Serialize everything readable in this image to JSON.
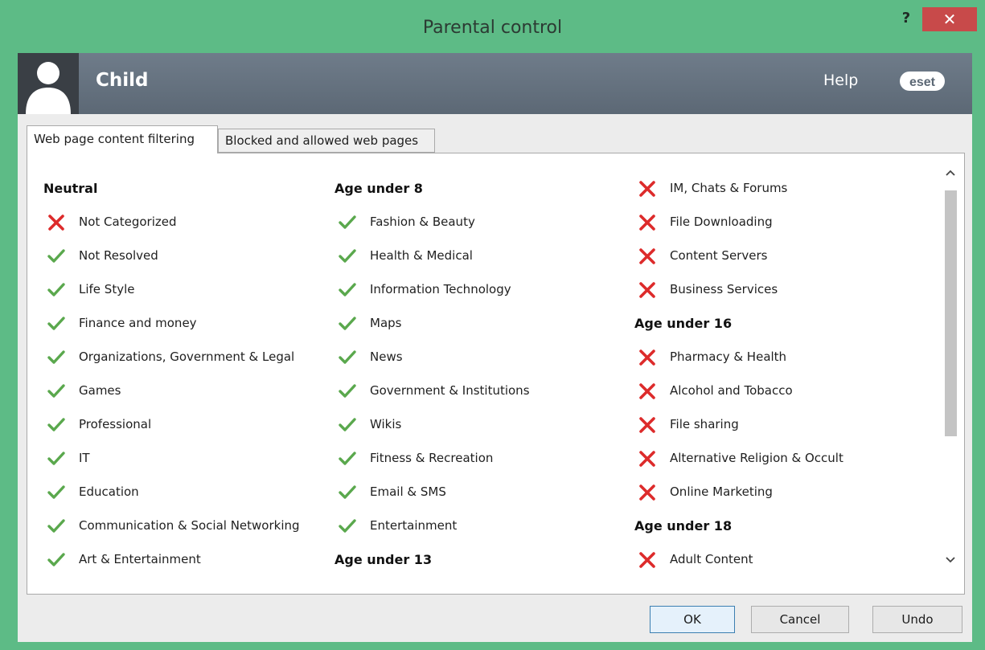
{
  "window": {
    "title": "Parental control",
    "help_glyph": "?",
    "close_glyph": "✕",
    "frame_color": "#5dbb86",
    "close_color": "#c84a4a"
  },
  "header": {
    "name": "Child",
    "help": "Help",
    "logo_text": "eset"
  },
  "tabs": [
    {
      "label": "Web page content filtering",
      "active": true
    },
    {
      "label": "Blocked and allowed web pages",
      "active": false
    }
  ],
  "columns": [
    {
      "groups": [
        {
          "title": "Neutral",
          "items": [
            {
              "label": "Not Categorized",
              "allowed": false
            },
            {
              "label": "Not Resolved",
              "allowed": true
            },
            {
              "label": "Life Style",
              "allowed": true
            },
            {
              "label": "Finance and money",
              "allowed": true
            },
            {
              "label": "Organizations, Government & Legal",
              "allowed": true
            },
            {
              "label": "Games",
              "allowed": true
            },
            {
              "label": "Professional",
              "allowed": true
            },
            {
              "label": "IT",
              "allowed": true
            },
            {
              "label": "Education",
              "allowed": true
            },
            {
              "label": "Communication & Social Networking",
              "allowed": true
            },
            {
              "label": "Art & Entertainment",
              "allowed": true
            }
          ]
        }
      ]
    },
    {
      "groups": [
        {
          "title": "Age under 8",
          "items": [
            {
              "label": "Fashion & Beauty",
              "allowed": true
            },
            {
              "label": "Health & Medical",
              "allowed": true
            },
            {
              "label": "Information Technology",
              "allowed": true
            },
            {
              "label": "Maps",
              "allowed": true
            },
            {
              "label": "News",
              "allowed": true
            },
            {
              "label": "Government & Institutions",
              "allowed": true
            },
            {
              "label": "Wikis",
              "allowed": true
            },
            {
              "label": "Fitness & Recreation",
              "allowed": true
            },
            {
              "label": "Email & SMS",
              "allowed": true
            },
            {
              "label": "Entertainment",
              "allowed": true
            }
          ]
        },
        {
          "title": "Age under 13",
          "items": []
        }
      ]
    },
    {
      "groups": [
        {
          "title": "",
          "items": [
            {
              "label": "IM, Chats & Forums",
              "allowed": false
            },
            {
              "label": "File Downloading",
              "allowed": false
            },
            {
              "label": "Content Servers",
              "allowed": false
            },
            {
              "label": "Business Services",
              "allowed": false
            }
          ]
        },
        {
          "title": "Age under 16",
          "items": [
            {
              "label": "Pharmacy & Health",
              "allowed": false
            },
            {
              "label": "Alcohol and Tobacco",
              "allowed": false
            },
            {
              "label": "File sharing",
              "allowed": false
            },
            {
              "label": "Alternative Religion & Occult",
              "allowed": false
            },
            {
              "label": "Online Marketing",
              "allowed": false
            }
          ]
        },
        {
          "title": "Age under 18",
          "items": [
            {
              "label": "Adult Content",
              "allowed": false
            }
          ]
        }
      ]
    }
  ],
  "icons": {
    "allowed": "check-icon",
    "blocked": "cross-icon",
    "allowed_color": "#5aa84d",
    "blocked_color": "#dd2b2b"
  },
  "buttons": {
    "ok": "OK",
    "cancel": "Cancel",
    "undo": "Undo"
  }
}
